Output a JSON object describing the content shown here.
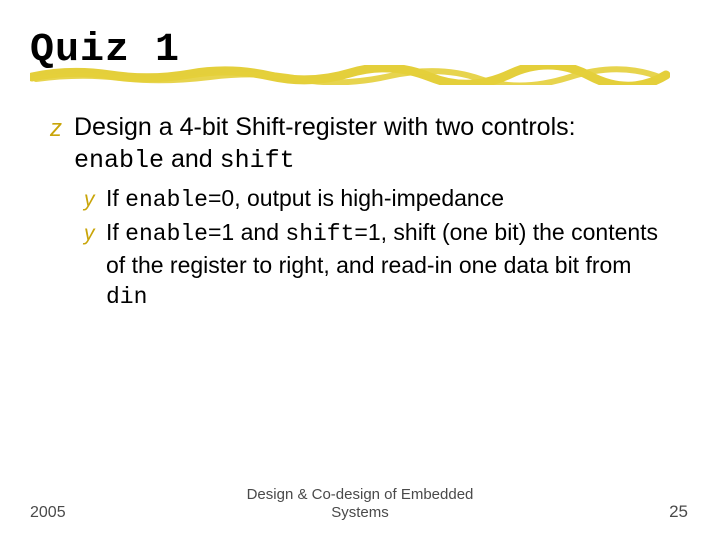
{
  "title": "Quiz 1",
  "body": {
    "l1_prefix": "Design a 4-bit Shift-register with two controls: ",
    "l1_code1": "enable",
    "l1_mid": " and ",
    "l1_code2": "shift",
    "sub": [
      {
        "a": "If ",
        "b": "enable",
        "c": "=0, output is high-impedance"
      },
      {
        "a": "If ",
        "b": "enable",
        "c": "=1 and ",
        "d": "shift",
        "e": "=1, shift (one bit) the contents of the register to right, and read-in one data bit from ",
        "f": "din"
      }
    ]
  },
  "bullets": {
    "l1": "z",
    "l2": "y"
  },
  "footer": {
    "left": "2005",
    "center_line1": "Design & Co-design of Embedded",
    "center_line2": "Systems",
    "right": "25"
  }
}
